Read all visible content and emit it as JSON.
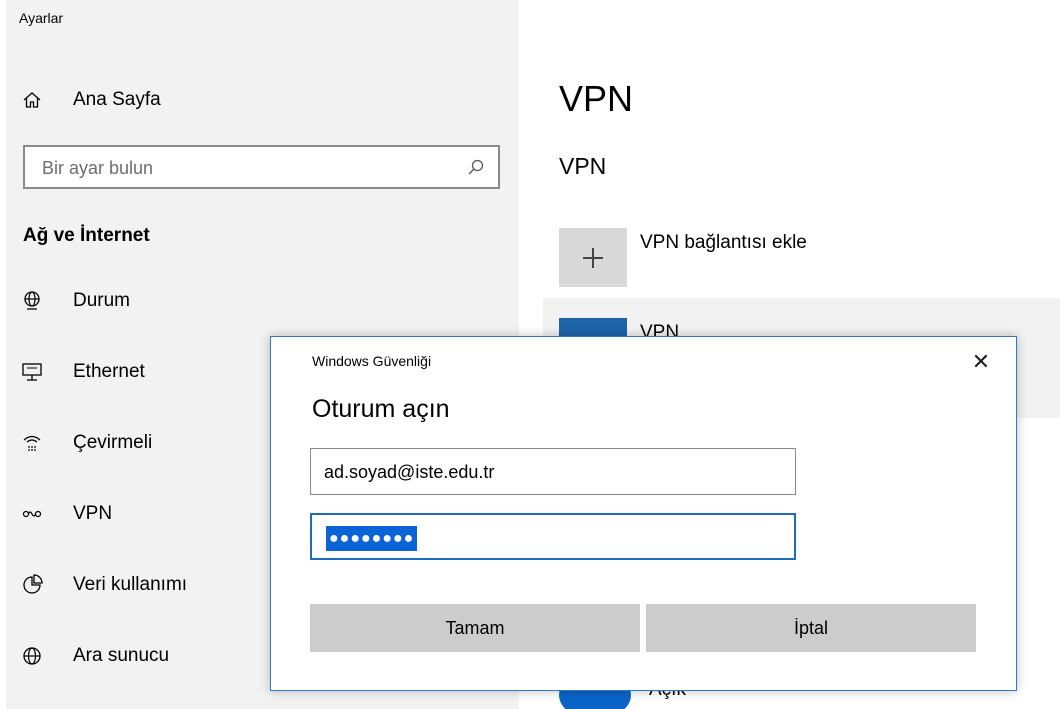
{
  "app": {
    "title": "Ayarlar"
  },
  "sidebar": {
    "home_label": "Ana Sayfa",
    "search_placeholder": "Bir ayar bulun",
    "section_title": "Ağ ve İnternet",
    "items": [
      {
        "label": "Durum",
        "icon": "globe-status-icon"
      },
      {
        "label": "Ethernet",
        "icon": "ethernet-icon"
      },
      {
        "label": "Çevirmeli",
        "icon": "dialup-icon"
      },
      {
        "label": "VPN",
        "icon": "vpn-icon"
      },
      {
        "label": "Veri kullanımı",
        "icon": "data-usage-icon"
      },
      {
        "label": "Ara sunucu",
        "icon": "proxy-globe-icon"
      }
    ]
  },
  "main": {
    "page_title": "VPN",
    "section_title": "VPN",
    "add_label": "VPN bağlantısı ekle",
    "connection_name": "VPN",
    "toggle_label": "Açık"
  },
  "dialog": {
    "caption": "Windows Güvenliği",
    "close_glyph": "✕",
    "heading": "Oturum açın",
    "username": "ad.soyad@iste.edu.tr",
    "password_mask": "●●●●●●●●",
    "ok_label": "Tamam",
    "cancel_label": "İptal"
  },
  "colors": {
    "sidebar_bg": "#f2f2f2",
    "accent": "#0a64c8",
    "dialog_border": "#2f78c4",
    "button_bg": "#cccccc"
  }
}
